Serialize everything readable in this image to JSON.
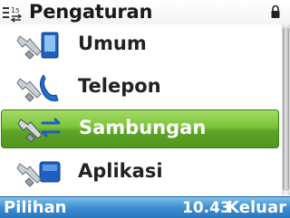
{
  "header": {
    "title": "Pengaturan",
    "icon": "settings-list-icon"
  },
  "menu": {
    "items": [
      {
        "label": "Umum",
        "icon": "general-settings-icon",
        "selected": false
      },
      {
        "label": "Telepon",
        "icon": "phone-settings-icon",
        "selected": false
      },
      {
        "label": "Sambungan",
        "icon": "connection-settings-icon",
        "selected": true
      },
      {
        "label": "Aplikasi",
        "icon": "application-settings-icon",
        "selected": false
      }
    ]
  },
  "softkeys": {
    "left": "Pilihan",
    "clock": "10.43",
    "right": "Keluar"
  },
  "colors": {
    "selection": "#6cb32f",
    "softkey_bar": "#3c8fd2",
    "text": "#222222"
  }
}
